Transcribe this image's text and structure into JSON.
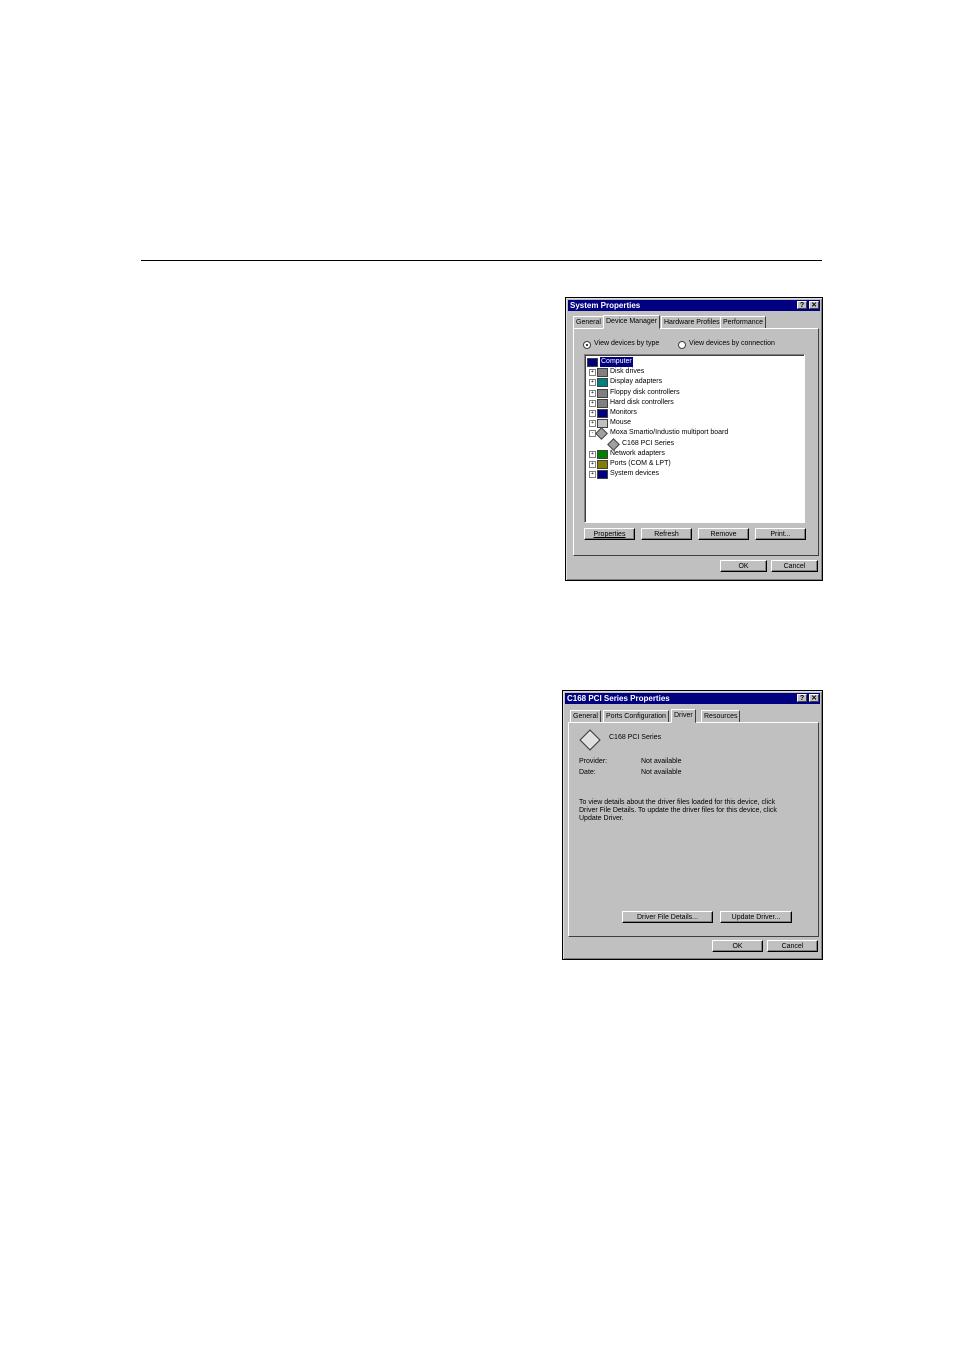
{
  "dialog1": {
    "title": "System Properties",
    "tabs": [
      "General",
      "Device Manager",
      "Hardware Profiles",
      "Performance"
    ],
    "active_tab": "Device Manager",
    "radio_by_type": "View devices by type",
    "radio_by_connection": "View devices by connection",
    "tree": [
      {
        "label": "Computer",
        "level": 0,
        "icon": "computer-icon",
        "selected": true
      },
      {
        "label": "Disk drives",
        "level": 1,
        "icon": "disk-drive-icon",
        "expander": "+"
      },
      {
        "label": "Display adapters",
        "level": 1,
        "icon": "display-adapter-icon",
        "expander": "+"
      },
      {
        "label": "Floppy disk controllers",
        "level": 1,
        "icon": "floppy-controller-icon",
        "expander": "+"
      },
      {
        "label": "Hard disk controllers",
        "level": 1,
        "icon": "hard-disk-controller-icon",
        "expander": "+"
      },
      {
        "label": "Monitors",
        "level": 1,
        "icon": "monitor-icon",
        "expander": "+"
      },
      {
        "label": "Mouse",
        "level": 1,
        "icon": "mouse-icon",
        "expander": "+"
      },
      {
        "label": "Moxa Smartio/Industio multiport board",
        "level": 1,
        "icon": "multiport-board-icon",
        "expander": "-"
      },
      {
        "label": "C168 PCI Series",
        "level": 2,
        "icon": "multiport-board-icon"
      },
      {
        "label": "Network adapters",
        "level": 1,
        "icon": "network-adapter-icon",
        "expander": "+"
      },
      {
        "label": "Ports (COM & LPT)",
        "level": 1,
        "icon": "port-icon",
        "expander": "+"
      },
      {
        "label": "System devices",
        "level": 1,
        "icon": "system-device-icon",
        "expander": "+"
      }
    ],
    "buttons": {
      "properties": "Properties",
      "refresh": "Refresh",
      "remove": "Remove",
      "print": "Print..."
    },
    "ok": "OK",
    "cancel": "Cancel"
  },
  "dialog2": {
    "title": "C168  PCI Series Properties",
    "tabs": [
      "General",
      "Ports Configuration",
      "Driver",
      "Resources"
    ],
    "active_tab": "Driver",
    "device_name": "C168 PCI Series",
    "provider_label": "Provider:",
    "provider_value": "Not available",
    "date_label": "Date:",
    "date_value": "Not available",
    "description": "To view details about the driver files loaded for this device, click Driver File Details.  To update the driver files for this device, click Update Driver.",
    "driver_file_details": "Driver File Details...",
    "update_driver": "Update Driver...",
    "ok": "OK",
    "cancel": "Cancel"
  }
}
